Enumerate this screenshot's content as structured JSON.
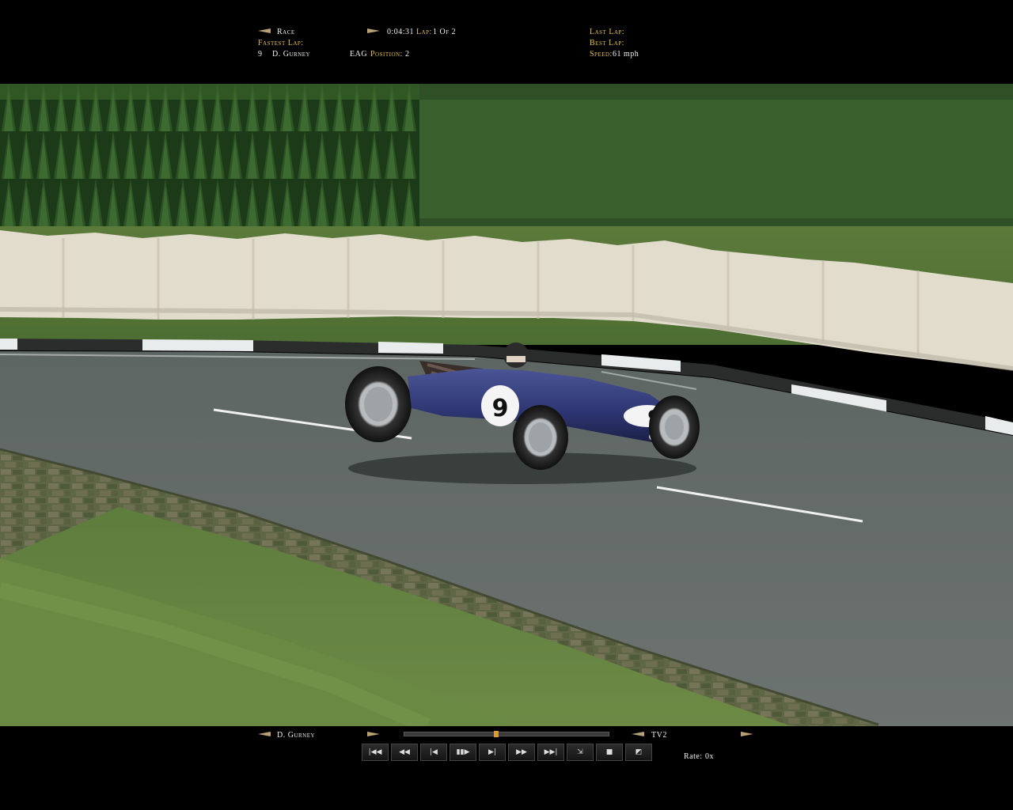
{
  "hud_top": {
    "session": "Race",
    "time": "0:04:31",
    "lap_label": "Lap:",
    "lap_value": "1 Of 2",
    "fastest_lap_label": "Fastest Lap:",
    "driver_number": "9",
    "driver_name": "D. Gurney",
    "team": "EAG",
    "position_label": "Position:",
    "position_value": "2",
    "last_lap_label": "Last Lap:",
    "best_lap_label": "Best Lap:",
    "speed_label": "Speed:",
    "speed_value": "61 mph"
  },
  "car": {
    "number": "9",
    "color": "#2d3570"
  },
  "replay": {
    "driver": "D. Gurney",
    "camera": "TV2",
    "rate_label": "Rate:",
    "rate_value": "0x",
    "progress": 0.45,
    "buttons": [
      {
        "name": "skip-to-start-button",
        "glyph": "|◀◀"
      },
      {
        "name": "rewind-button",
        "glyph": "◀◀"
      },
      {
        "name": "step-back-button",
        "glyph": "|◀"
      },
      {
        "name": "pause-button",
        "glyph": "▮▮▶"
      },
      {
        "name": "step-forward-button",
        "glyph": "▶|"
      },
      {
        "name": "fast-forward-button",
        "glyph": "▶▶"
      },
      {
        "name": "skip-to-end-button",
        "glyph": "▶▶|"
      },
      {
        "name": "loop-button",
        "glyph": "⇲"
      },
      {
        "name": "save-button",
        "glyph": "■"
      },
      {
        "name": "camera-button",
        "glyph": "◩"
      }
    ]
  }
}
